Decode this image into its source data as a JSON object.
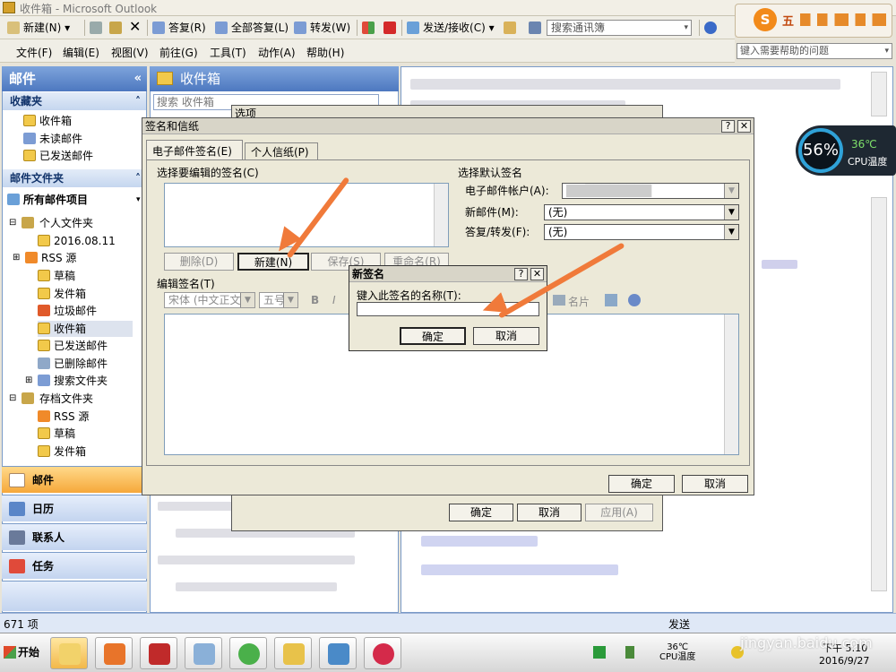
{
  "window": {
    "title": "收件箱 - Microsoft Outlook"
  },
  "toolbar": {
    "new": "新建(N)",
    "reply": "答复(R)",
    "reply_all": "全部答复(L)",
    "forward": "转发(W)",
    "send_receive": "发送/接收(C)",
    "address_search": "搜索通讯簿"
  },
  "menu": [
    "文件(F)",
    "编辑(E)",
    "视图(V)",
    "前往(G)",
    "工具(T)",
    "动作(A)",
    "帮助(H)"
  ],
  "help_box": "键入需要帮助的问题",
  "ime": {
    "label": "五"
  },
  "nav": {
    "header": "邮件",
    "favorites_title": "收藏夹",
    "favorites": [
      "收件箱",
      "未读邮件",
      "已发送邮件"
    ],
    "mail_folders_title": "邮件文件夹",
    "all_items": "所有邮件项目",
    "personal": "个人文件夹",
    "folders": [
      "2016.08.11",
      "RSS 源",
      "草稿",
      "发件箱",
      "垃圾邮件",
      "收件箱",
      "已发送邮件",
      "已删除邮件",
      "搜索文件夹"
    ],
    "archive": "存档文件夹",
    "archive_folders": [
      "RSS 源",
      "草稿",
      "发件箱"
    ],
    "buttons": [
      "邮件",
      "日历",
      "联系人",
      "任务"
    ]
  },
  "inbox": {
    "title": "收件箱",
    "search_placeholder": "搜索 收件箱"
  },
  "status": {
    "count": "671 项",
    "right": "发送"
  },
  "cpu": {
    "percent": "56%",
    "temp": "36℃",
    "label": "CPU温度"
  },
  "options_dialog": {
    "title": "选项",
    "ok": "确定",
    "cancel": "取消",
    "apply": "应用(A)"
  },
  "sig_dialog": {
    "title": "签名和信纸",
    "tab1": "电子邮件签名(E)",
    "tab2": "个人信纸(P)",
    "select_label": "选择要编辑的签名(C)",
    "default_label": "选择默认签名",
    "account_label": "电子邮件帐户(A):",
    "new_msg_label": "新邮件(M):",
    "new_msg_value": "(无)",
    "reply_label": "答复/转发(F):",
    "reply_value": "(无)",
    "delete_btn": "删除(D)",
    "new_btn": "新建(N)",
    "save_btn": "保存(S)",
    "rename_btn": "重命名(R)",
    "edit_label": "编辑签名(T)",
    "font": "宋体 (中文正文",
    "size": "五号",
    "business_card": "名片",
    "ok": "确定",
    "cancel": "取消"
  },
  "new_sig_dialog": {
    "title": "新签名",
    "prompt": "键入此签名的名称(T):",
    "value": "",
    "ok": "确定",
    "cancel": "取消"
  },
  "taskbar": {
    "start": "开始",
    "time": "5:10",
    "ampm": "下午",
    "date": "2016/9/27",
    "tray_temp": "36℃",
    "tray_label": "CPU温度"
  },
  "watermark": "jingyan.baidu.com"
}
